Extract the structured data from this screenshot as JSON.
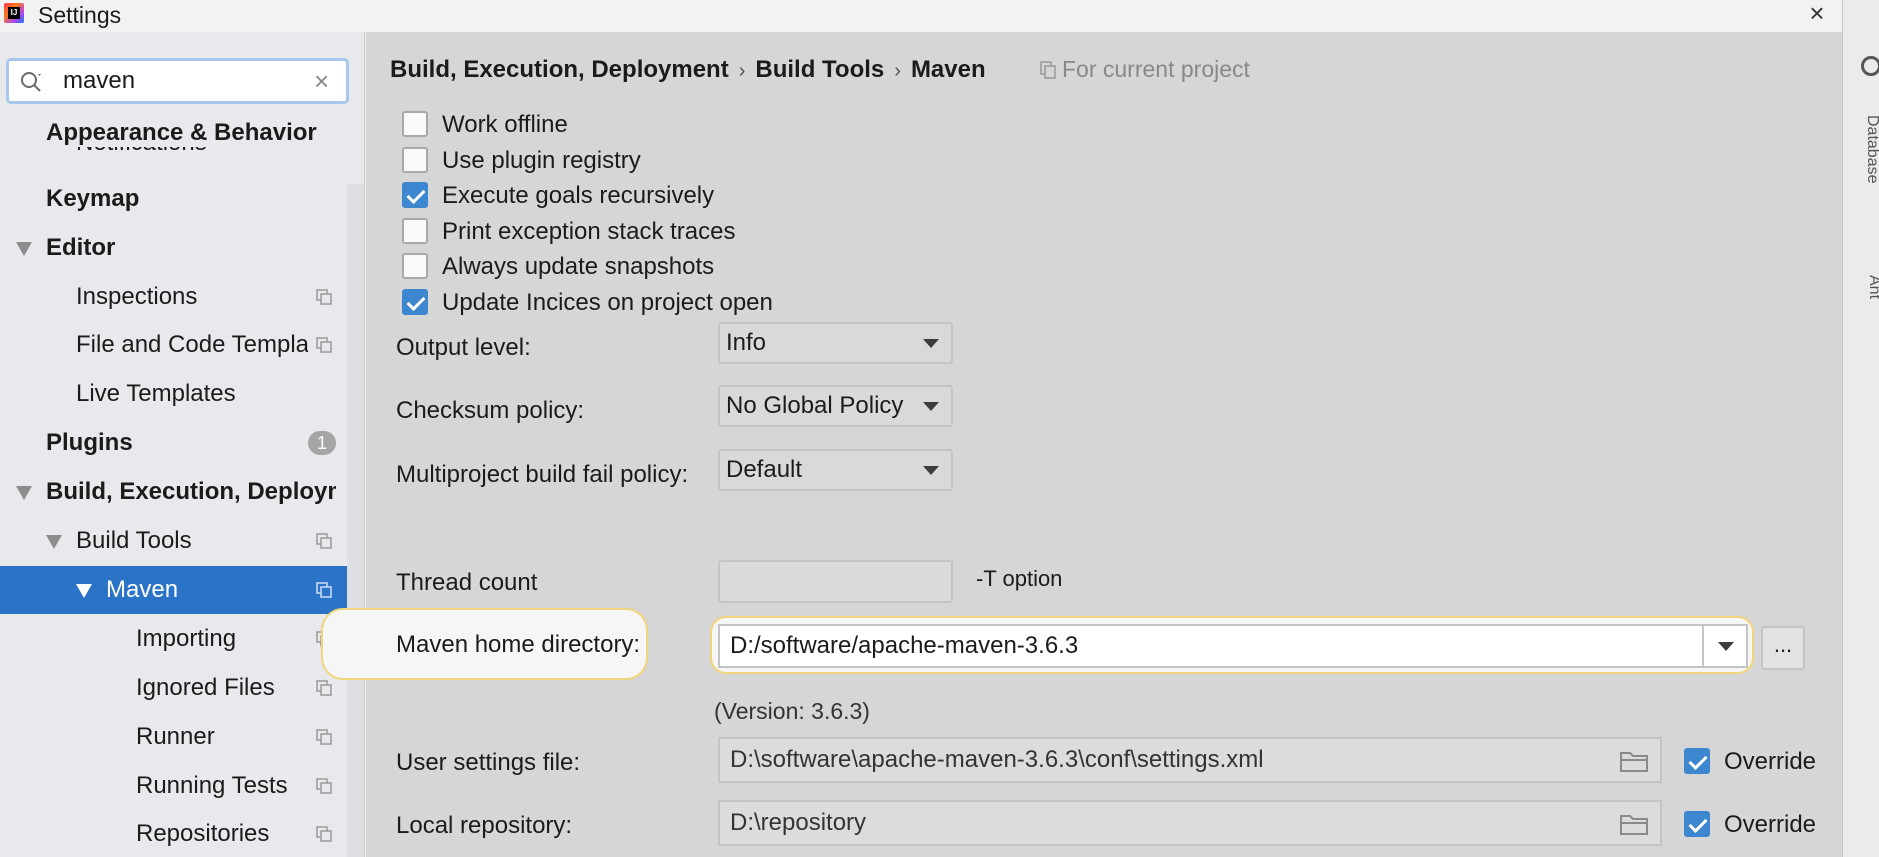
{
  "window": {
    "title": "Settings",
    "close_label": "×",
    "logo_text": "IJ"
  },
  "sidebar": {
    "search": {
      "value": "maven",
      "clear_label": "×"
    },
    "items": [
      {
        "label": "Appearance & Behavior",
        "bold": true
      },
      {
        "label": "Notifications"
      },
      {
        "label": "Keymap",
        "bold": true
      },
      {
        "label": "Editor",
        "bold": true,
        "expanded": true
      },
      {
        "label": "Inspections"
      },
      {
        "label": "File and Code Templat"
      },
      {
        "label": "Live Templates"
      },
      {
        "label": "Plugins",
        "bold": true,
        "badge": "1"
      },
      {
        "label": "Build, Execution, Deploym",
        "bold": true,
        "expanded": true
      },
      {
        "label": "Build Tools",
        "expanded": true
      },
      {
        "label": "Maven",
        "expanded": true,
        "selected": true
      },
      {
        "label": "Importing"
      },
      {
        "label": "Ignored Files"
      },
      {
        "label": "Runner"
      },
      {
        "label": "Running Tests"
      },
      {
        "label": "Repositories"
      }
    ]
  },
  "breadcrumb": {
    "parts": [
      "Build, Execution, Deployment",
      "Build Tools",
      "Maven"
    ],
    "separator": "›",
    "scope": "For current project"
  },
  "options": [
    {
      "label": "Work offline",
      "checked": false
    },
    {
      "label": "Use plugin registry",
      "checked": false
    },
    {
      "label": "Execute goals recursively",
      "checked": true
    },
    {
      "label": "Print exception stack traces",
      "checked": false
    },
    {
      "label": "Always update snapshots",
      "checked": false
    },
    {
      "label": "Update Incices on project open",
      "checked": true
    }
  ],
  "fields": {
    "output_level": {
      "label": "Output level:",
      "value": "Info"
    },
    "checksum_policy": {
      "label": "Checksum policy:",
      "value": "No Global Policy"
    },
    "multiproject_fail_policy": {
      "label": "Multiproject build fail policy:",
      "value": "Default"
    },
    "thread_count": {
      "label": "Thread count",
      "value": "",
      "hint": "-T option"
    },
    "maven_home": {
      "label": "Maven home directory:",
      "value": "D:/software/apache-maven-3.6.3",
      "browse_label": "...",
      "version": "(Version: 3.6.3)"
    },
    "user_settings": {
      "label": "User settings file:",
      "value": "D:\\software\\apache-maven-3.6.3\\conf\\settings.xml",
      "override_label": "Override",
      "override_checked": true
    },
    "local_repository": {
      "label": "Local repository:",
      "value": "D:\\repository",
      "override_label": "Override",
      "override_checked": true
    }
  },
  "right_strip": {
    "database_label": "Database",
    "ant_label": "Ant"
  },
  "colors": {
    "selection": "#2a73c6",
    "checkbox_checked": "#3d86d0",
    "highlight_border": "#f2d57a"
  }
}
